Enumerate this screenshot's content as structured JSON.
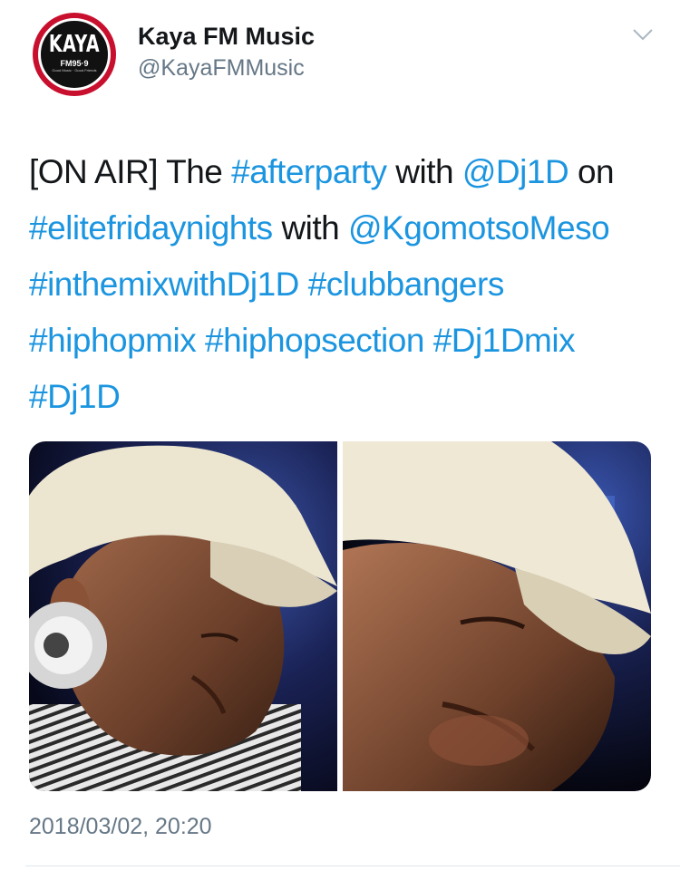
{
  "account": {
    "display_name": "Kaya FM Music",
    "handle": "@KayaFMMusic",
    "avatar": {
      "logo_text": "KAYA",
      "frequency": "FM95·9",
      "tagline": "Good Music · Good Friends"
    }
  },
  "menu_icon": "chevron-down-icon",
  "tweet": {
    "segments": [
      {
        "text": "[ON AIR] The ",
        "type": "text"
      },
      {
        "text": "#afterparty",
        "type": "hashtag"
      },
      {
        "text": "  with ",
        "type": "text"
      },
      {
        "text": "@Dj1D",
        "type": "mention"
      },
      {
        "text": " on ",
        "type": "text"
      },
      {
        "text": "#elitefridaynights",
        "type": "hashtag"
      },
      {
        "text": " with ",
        "type": "text"
      },
      {
        "text": "@KgomotsoMeso",
        "type": "mention"
      },
      {
        "text": " ",
        "type": "text"
      },
      {
        "text": "#inthemixwithDj1D",
        "type": "hashtag"
      },
      {
        "text": " ",
        "type": "text"
      },
      {
        "text": "#clubbangers",
        "type": "hashtag"
      },
      {
        "text": " ",
        "type": "text"
      },
      {
        "text": "#hiphopmix",
        "type": "hashtag"
      },
      {
        "text": " ",
        "type": "text"
      },
      {
        "text": "#hiphopsection",
        "type": "hashtag"
      },
      {
        "text": " ",
        "type": "text"
      },
      {
        "text": "#Dj1Dmix",
        "type": "hashtag"
      },
      {
        "text": " ",
        "type": "text"
      },
      {
        "text": "#Dj1D",
        "type": "hashtag"
      }
    ],
    "timestamp": "2018/03/02, 20:20"
  },
  "media": {
    "photos": [
      {
        "subject": "dj-wearing-cap-with-headphones"
      },
      {
        "subject": "dj-wearing-cap-closeup"
      }
    ]
  },
  "colors": {
    "link": "#1b95e0",
    "text": "#14171a",
    "secondary": "#657786",
    "brand_red": "#c8102e"
  }
}
